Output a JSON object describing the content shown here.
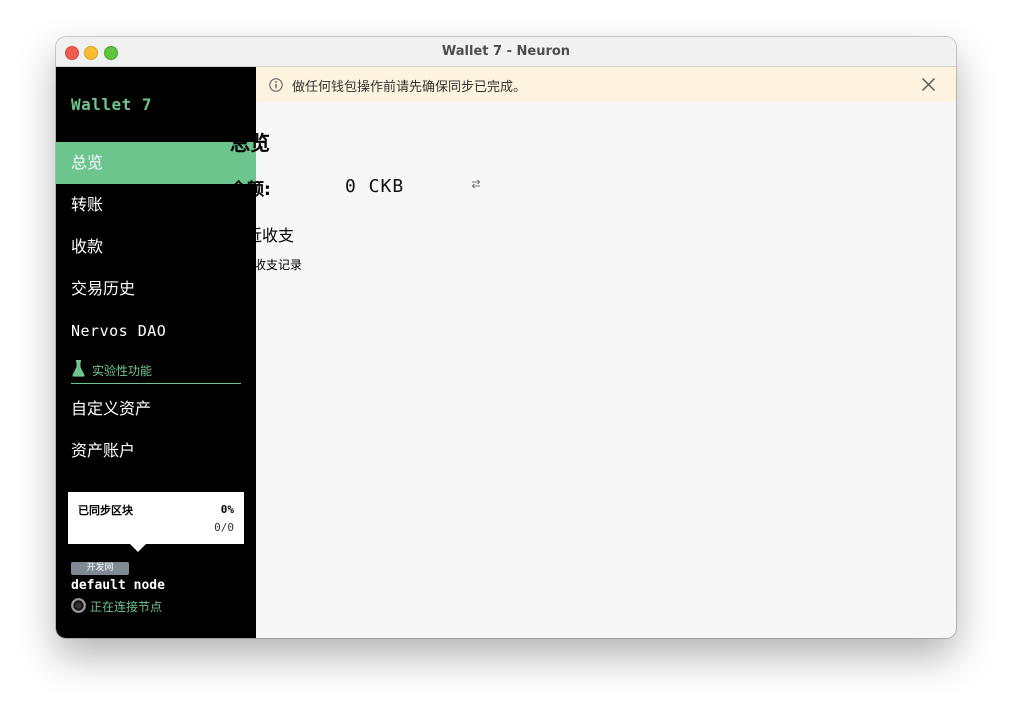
{
  "window": {
    "title": "Wallet 7 - Neuron"
  },
  "sidebar": {
    "wallet_name": "Wallet 7",
    "items": [
      {
        "label": "总览"
      },
      {
        "label": "转账"
      },
      {
        "label": "收款"
      },
      {
        "label": "交易历史"
      },
      {
        "label": "Nervos DAO"
      }
    ],
    "experimental_label": "实验性功能",
    "experimental_items": [
      {
        "label": "自定义资产"
      },
      {
        "label": "资产账户"
      }
    ],
    "sync": {
      "label": "已同步区块",
      "percent": "0%",
      "blocks": "0/0"
    },
    "network": {
      "badge": "开发网",
      "node_name": "default node",
      "status": "正在连接节点"
    }
  },
  "alert": {
    "text": "做任何钱包操作前请先确保同步已完成。"
  },
  "main": {
    "title": "总览",
    "balance_label": "余额:",
    "balance_value": "0 CKB",
    "recent_title": "最近收支",
    "empty_text": "没有收支记录"
  },
  "colors": {
    "accent": "#6bc58c",
    "sidebar_bg": "#000000",
    "alert_bg": "#fdf3de",
    "badge_bg": "#7f8a95"
  }
}
